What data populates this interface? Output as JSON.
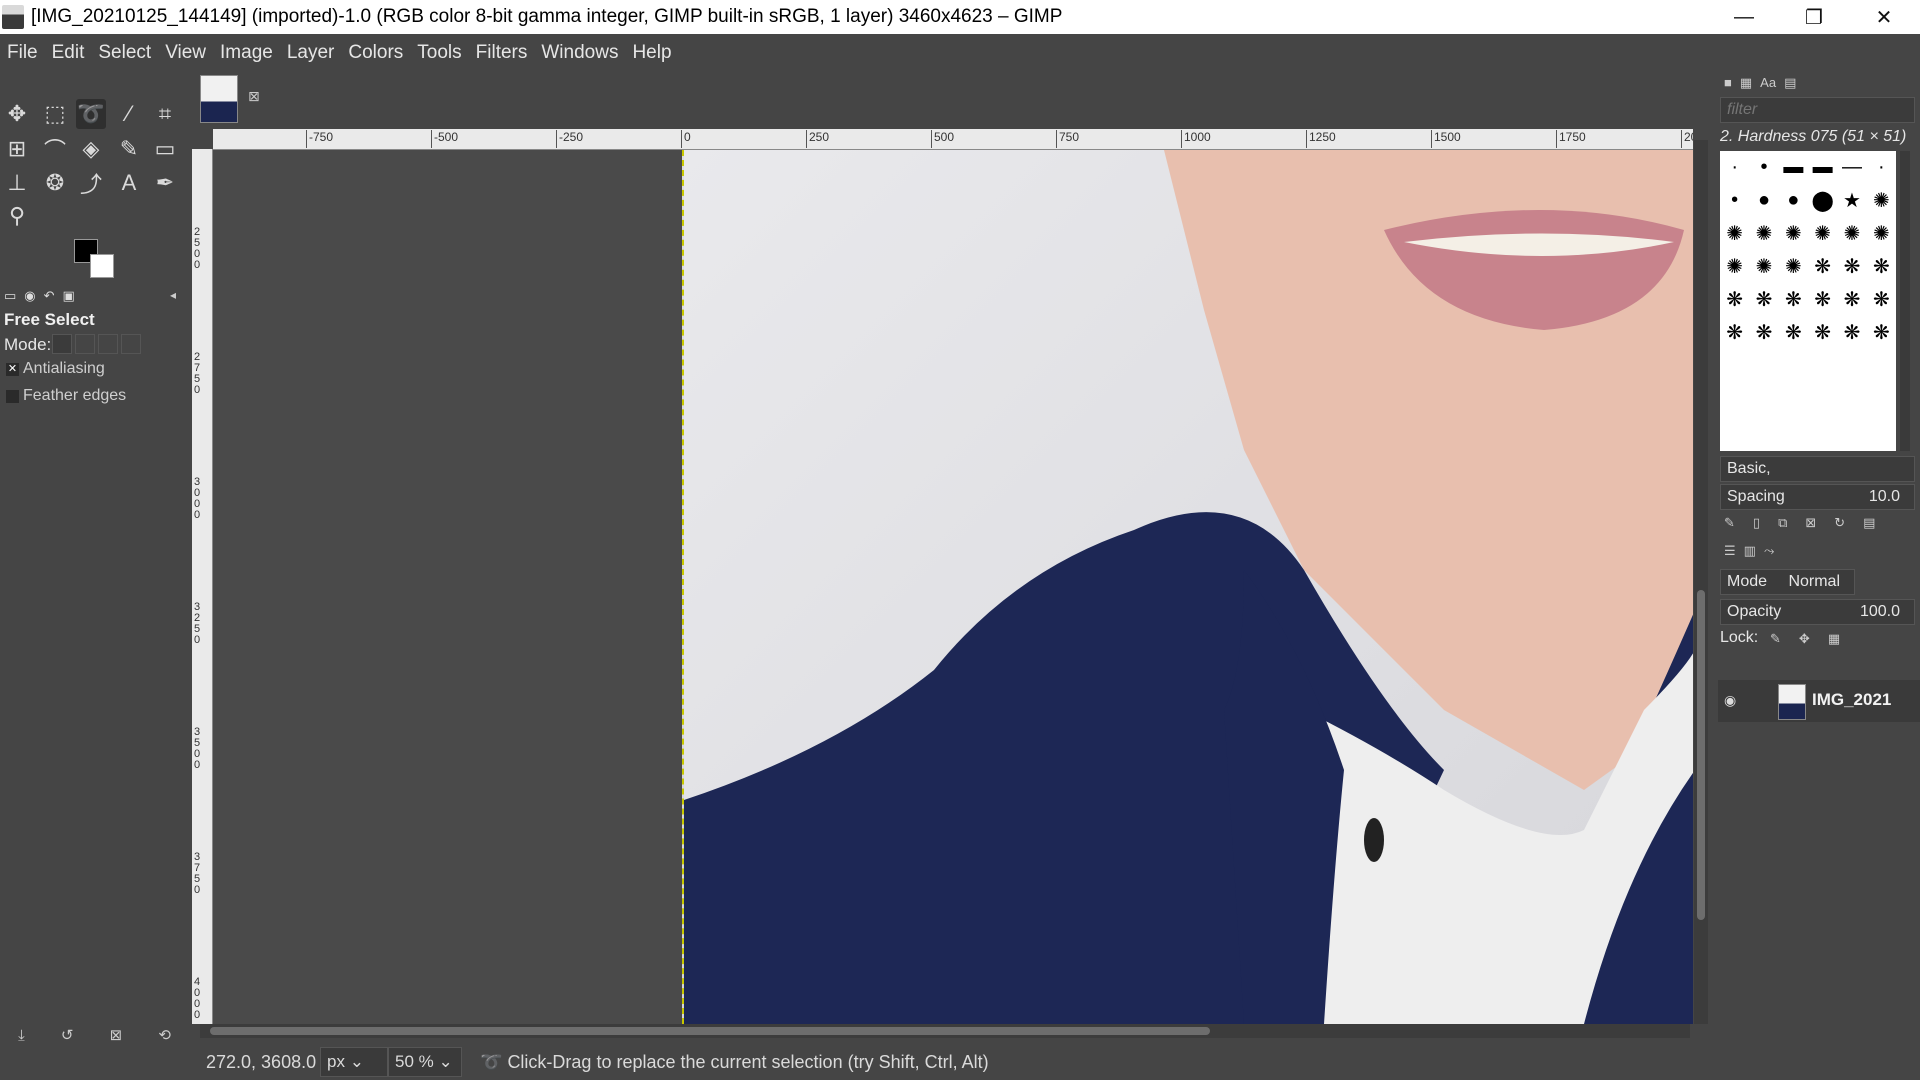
{
  "window": {
    "title": "[IMG_20210125_144149] (imported)-1.0 (RGB color 8-bit gamma integer, GIMP built-in sRGB, 1 layer) 3460x4623 – GIMP",
    "minimize": "—",
    "maximize": "❐",
    "close": "✕"
  },
  "menu": [
    "File",
    "Edit",
    "Select",
    "View",
    "Image",
    "Layer",
    "Colors",
    "Tools",
    "Filters",
    "Windows",
    "Help"
  ],
  "tool_options": {
    "title": "Free Select",
    "mode_label": "Mode:",
    "antialiasing": "Antialiasing",
    "antialiasing_checked": true,
    "feather": "Feather edges",
    "feather_checked": false
  },
  "colors": {
    "foreground": "#000000",
    "background": "#ffffff"
  },
  "ruler": {
    "h_labels": [
      "-750",
      "-500",
      "-250",
      "0",
      "250",
      "500",
      "750",
      "1000",
      "1250",
      "1500",
      "1750",
      "20"
    ],
    "v_labels": [
      "2500",
      "2750",
      "3000",
      "3250",
      "3500",
      "3750",
      "4000"
    ]
  },
  "status": {
    "coords": "272.0, 3608.0",
    "unit": "px",
    "zoom": "50 %",
    "message": "Click-Drag to replace the current selection (try Shift, Ctrl, Alt)"
  },
  "brushes": {
    "filter_placeholder": "filter",
    "selected_name": "2. Hardness 075 (51 × 51)",
    "preset": "Basic,",
    "spacing_label": "Spacing",
    "spacing_value": "10.0"
  },
  "layers": {
    "mode_label": "Mode",
    "mode_value": "Normal",
    "opacity_label": "Opacity",
    "opacity_value": "100.0",
    "lock_label": "Lock:",
    "layer_name": "IMG_2021"
  }
}
